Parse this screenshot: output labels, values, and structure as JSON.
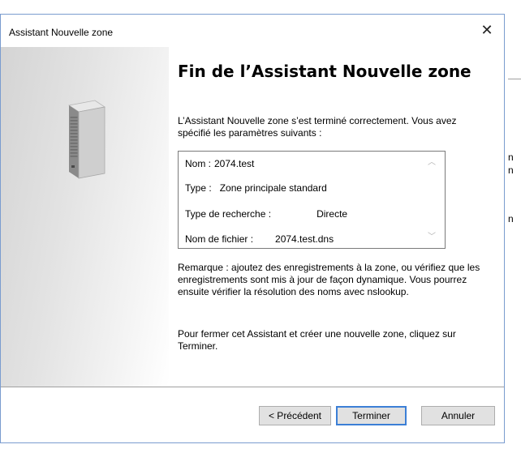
{
  "window": {
    "title": "Assistant Nouvelle zone",
    "close_glyph": "✕"
  },
  "background_window": {
    "letters": [
      "n",
      "n",
      "n"
    ]
  },
  "page": {
    "heading": "Fin de l’Assistant Nouvelle zone",
    "intro": "L’Assistant Nouvelle zone s’est terminé correctement. Vous avez spécifié les paramètres suivants :",
    "summary": [
      {
        "label": "Nom :",
        "value": "2074.test"
      },
      {
        "label": "Type :",
        "value": "Zone principale standard"
      },
      {
        "label": "Type de recherche :",
        "value": "Directe"
      },
      {
        "label": "Nom de fichier :",
        "value": "2074.test.dns"
      }
    ],
    "remark": "Remarque : ajoutez des enregistrements à la zone, ou vérifiez que les enregistrements sont mis à jour de façon dynamique. Vous pourrez ensuite vérifier la résolution des noms avec nslookup.",
    "closing": "Pour fermer cet Assistant et créer une nouvelle zone, cliquez sur Terminer."
  },
  "buttons": {
    "previous": "< Précédent",
    "finish": "Terminer",
    "cancel": "Annuler"
  },
  "icons": {
    "server": "server-tower-icon",
    "close": "close-icon",
    "scroll_up": "chevron-up-icon",
    "scroll_down": "chevron-down-icon"
  },
  "colors": {
    "accent_border": "#3c7fd6",
    "window_border": "#7a9ccf"
  }
}
